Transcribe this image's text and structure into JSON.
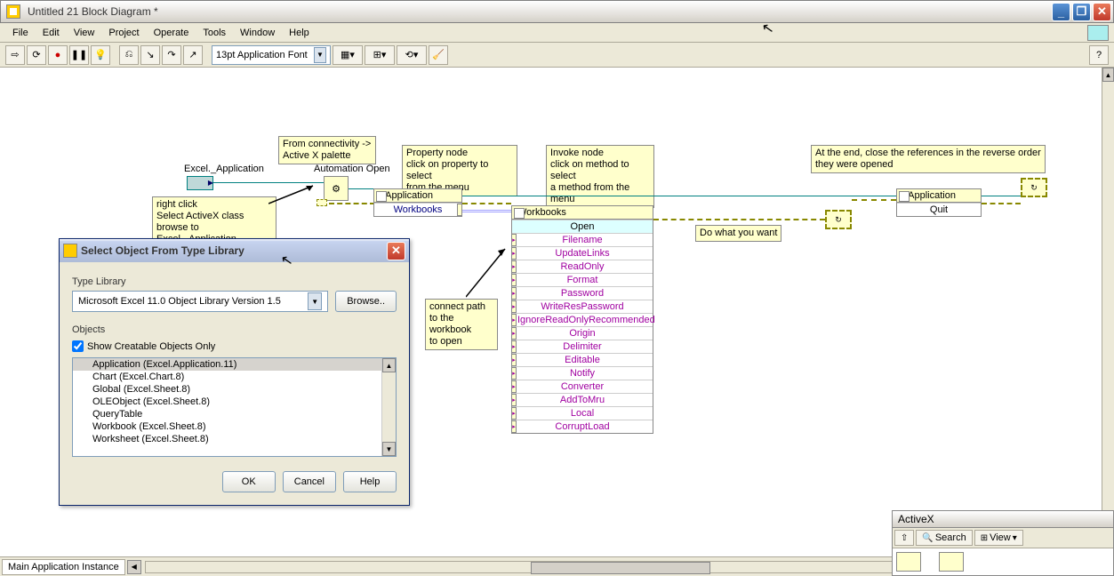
{
  "window": {
    "title": "Untitled 21 Block Diagram *"
  },
  "menu": {
    "items": [
      "File",
      "Edit",
      "View",
      "Project",
      "Operate",
      "Tools",
      "Window",
      "Help"
    ]
  },
  "toolbar": {
    "font": "13pt Application Font"
  },
  "diagram": {
    "excel_app_label": "Excel._Application",
    "automation_open_label": "Automation Open",
    "note_connectivity": "From connectivity ->\nActive X palette",
    "note_rightclick": "right click\nSelect ActiveX class\nbrowse to Excel._Application",
    "note_propnode": "Property node\nclick on property to select\nfrom the menu",
    "note_invoke": "Invoke node\nclick on method to select\na method from the menu",
    "note_connect": "connect path\nto the workbook\nto open",
    "note_do": "Do what you want",
    "note_close": "At the end, close the references in the reverse order\nthey were opened",
    "prop_app": {
      "header": "_Application",
      "row": "Workbooks"
    },
    "invoke_wb": {
      "header": "Workbooks",
      "method": "Open",
      "args": [
        "Filename",
        "UpdateLinks",
        "ReadOnly",
        "Format",
        "Password",
        "WriteResPassword",
        "IgnoreReadOnlyRecommended",
        "Origin",
        "Delimiter",
        "Editable",
        "Notify",
        "Converter",
        "AddToMru",
        "Local",
        "CorruptLoad"
      ]
    },
    "prop_app2": {
      "header": "_Application",
      "row": "Quit"
    }
  },
  "dialog": {
    "title": "Select Object From Type Library",
    "label_typelib": "Type Library",
    "typelib_value": "Microsoft Excel 11.0 Object Library Version 1.5",
    "browse": "Browse..",
    "label_objects": "Objects",
    "show_creatable": "Show Creatable Objects Only",
    "objects": [
      "Application (Excel.Application.11)",
      "Chart (Excel.Chart.8)",
      "Global (Excel.Sheet.8)",
      "OLEObject (Excel.Sheet.8)",
      "QueryTable",
      "Workbook (Excel.Sheet.8)",
      "Worksheet (Excel.Sheet.8)"
    ],
    "ok": "OK",
    "cancel": "Cancel",
    "help": "Help"
  },
  "palette": {
    "title": "ActiveX",
    "search": "Search",
    "view": "View"
  },
  "status": {
    "tab": "Main Application Instance"
  }
}
